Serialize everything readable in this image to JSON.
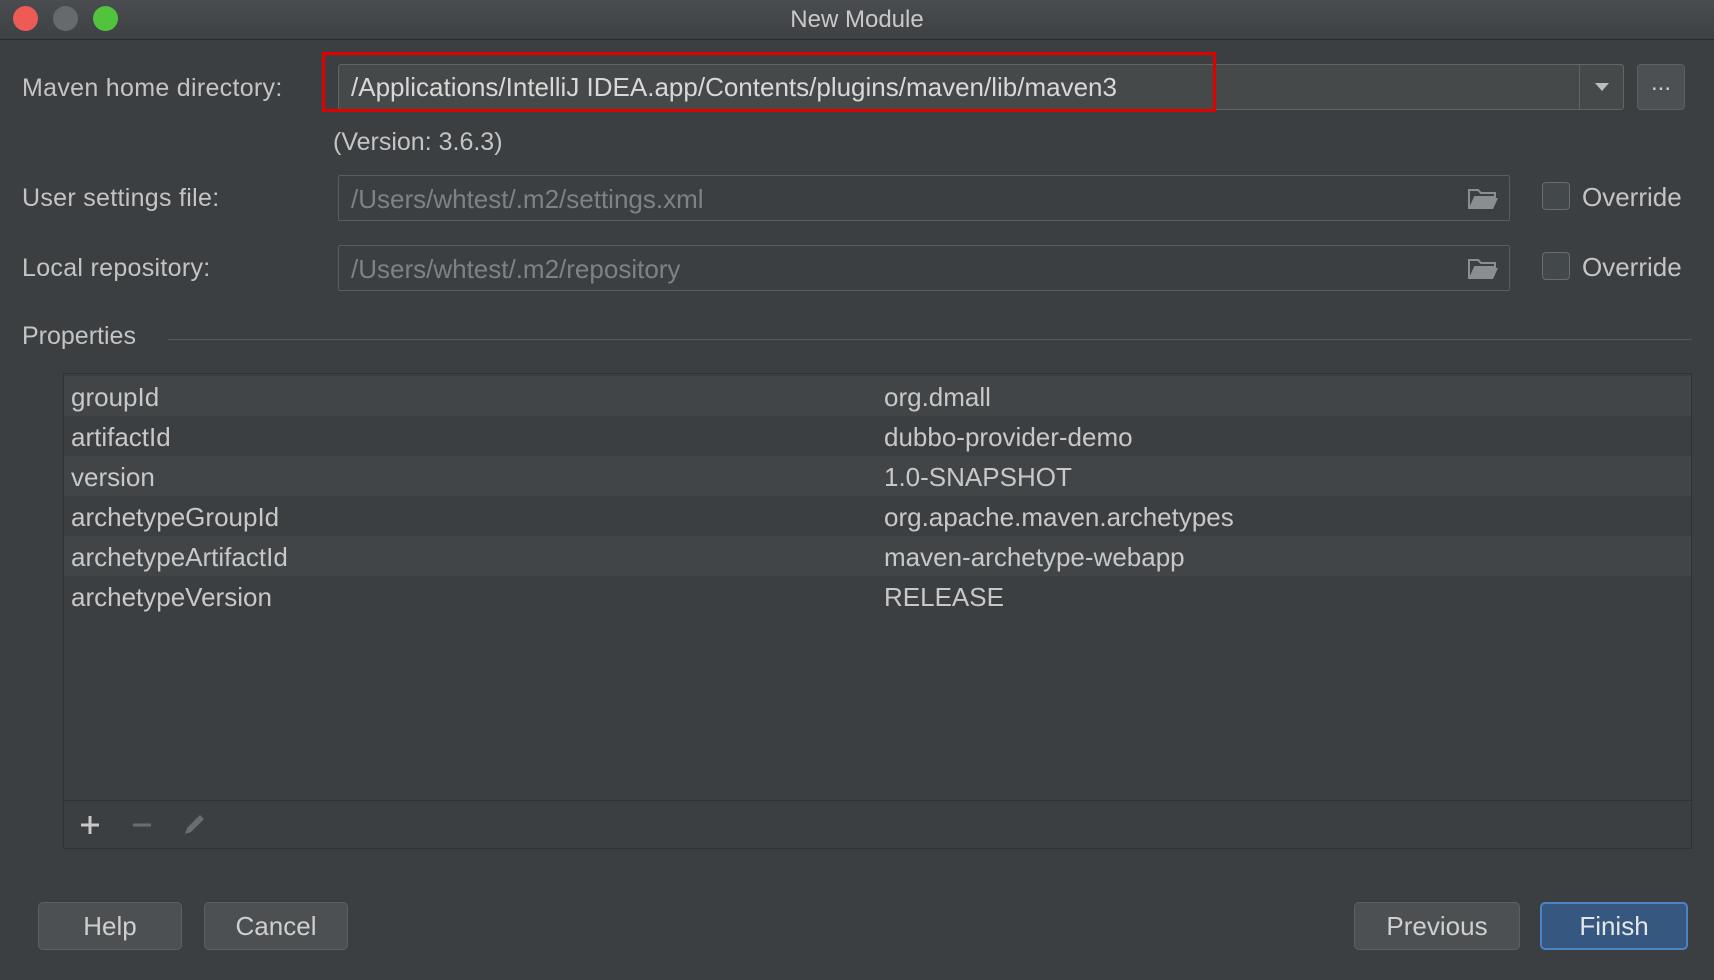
{
  "window": {
    "title": "New Module"
  },
  "maven": {
    "home_label": "Maven home directory:",
    "home_value": "/Applications/IntelliJ IDEA.app/Contents/plugins/maven/lib/maven3",
    "browse_label": "...",
    "version_text": "(Version: 3.6.3)",
    "settings_label": "User settings file:",
    "settings_value": "/Users/whtest/.m2/settings.xml",
    "settings_override": "Override",
    "repo_label": "Local repository:",
    "repo_value": "/Users/whtest/.m2/repository",
    "repo_override": "Override"
  },
  "properties": {
    "title": "Properties",
    "rows": [
      {
        "key": "groupId",
        "value": "org.dmall"
      },
      {
        "key": "artifactId",
        "value": "dubbo-provider-demo"
      },
      {
        "key": "version",
        "value": "1.0-SNAPSHOT"
      },
      {
        "key": "archetypeGroupId",
        "value": "org.apache.maven.archetypes"
      },
      {
        "key": "archetypeArtifactId",
        "value": "maven-archetype-webapp"
      },
      {
        "key": "archetypeVersion",
        "value": "RELEASE"
      }
    ]
  },
  "buttons": {
    "help": "Help",
    "cancel": "Cancel",
    "previous": "Previous",
    "finish": "Finish"
  },
  "colors": {
    "background": "#3c3f41",
    "highlight": "#e00000",
    "primary": "#365880",
    "close": "#ee5b55",
    "maximize": "#52c33c"
  },
  "icons": [
    "close-icon",
    "minimize-icon",
    "maximize-icon",
    "chevron-down-icon",
    "folder-icon",
    "plus-icon",
    "minus-icon",
    "pencil-icon"
  ]
}
